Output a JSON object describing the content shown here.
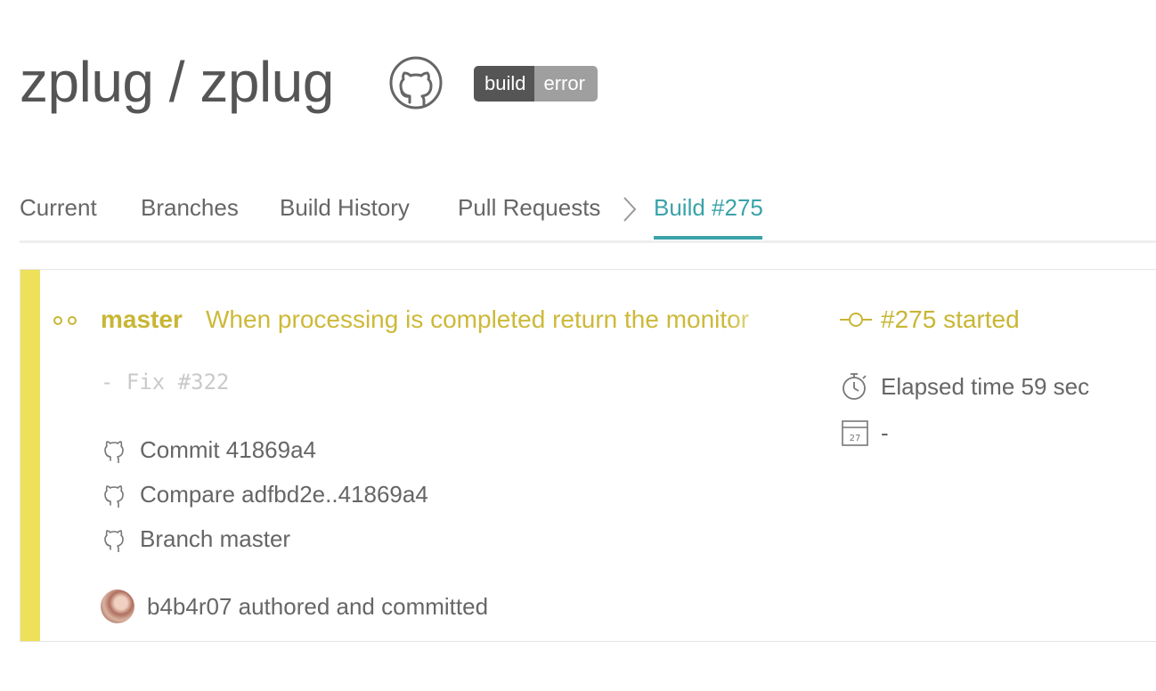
{
  "header": {
    "owner": "zplug",
    "separator": "/",
    "repo": "zplug",
    "badge": {
      "left": "build",
      "right": "error"
    }
  },
  "tabs": [
    {
      "label": "Current"
    },
    {
      "label": "Branches"
    },
    {
      "label": "Build History"
    },
    {
      "label": "Pull Requests"
    },
    {
      "label": "Build #275",
      "active": true
    }
  ],
  "build": {
    "state": "started",
    "stripe_color": "#ede05a",
    "branch": "master",
    "commit_message": "When processing is completed return the monitor",
    "commit_body": "- Fix #322",
    "commit_link": "Commit 41869a4",
    "compare_link": "Compare adfbd2e..41869a4",
    "branch_link": "Branch master",
    "author_text": "b4b4r07 authored and committed",
    "number_status": "#275 started",
    "elapsed": "Elapsed time 59 sec",
    "finished": "-",
    "calendar_day": "27"
  },
  "colors": {
    "accent": "#3aa3a9",
    "started": "#c8b634",
    "badge_dark": "#555555",
    "badge_light": "#9f9f9f"
  },
  "icons": {
    "repo": "github-octocat-icon",
    "links": "github-octocat-icon",
    "started": "commit-node-icon",
    "elapsed": "stopwatch-icon",
    "finished": "calendar-icon",
    "state": "two-dots-icon",
    "breadcrumb": "chevron-right-icon"
  }
}
